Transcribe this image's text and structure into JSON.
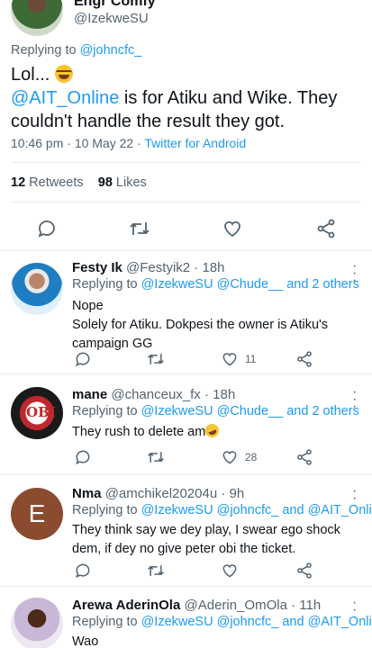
{
  "main_tweet": {
    "author_name": "Engr Comfy",
    "author_handle": "@IzekweSU",
    "replying_to_prefix": "Replying to ",
    "replying_to": "@johncfc_",
    "text_line1": "Lol... ",
    "mention": "@AIT_Online",
    "text_rest": " is for Atiku and Wike. They couldn't handle the result they got.",
    "time_date": "10:46 pm · 10 May 22 · ",
    "source": "Twitter for Android",
    "retweets": "12",
    "retweets_label": "Retweets",
    "likes": "98",
    "likes_label": "Likes"
  },
  "replies": [
    {
      "name": "Festy Ik",
      "handle_time": "@Festyik2 · 18h",
      "replying_prefix": "Replying to ",
      "replying_mentions": "@IzekweSU @Chude__ and 2 others",
      "text": "Nope\nSolely for Atiku. Dokpesi the owner is Atiku's campaign GG",
      "like_count": "11"
    },
    {
      "name": "mane",
      "handle_time": "@chanceux_fx · 18h",
      "replying_prefix": "Replying to ",
      "replying_mentions": "@IzekweSU @Chude__ and 2 others",
      "text": "They rush to delete am",
      "like_count": "28",
      "avatar_text": "OBI"
    },
    {
      "name": "Nma",
      "handle_time": "@amchikel20204u · 9h",
      "replying_prefix": "Replying to ",
      "replying_mentions": "@IzekweSU @johncfc_ and @AIT_Online",
      "text": "They think say we dey play, I swear ego shock dem, if dey no give peter obi the ticket.",
      "like_count": "",
      "avatar_letter": "E"
    },
    {
      "name": "Arewa AderinOla",
      "handle_time": "@Aderin_OmOla · 11h",
      "replying_prefix": "Replying to ",
      "replying_mentions": "@IzekweSU @johncfc_ and @AIT_Online",
      "text": "Wao"
    }
  ],
  "colors": {
    "accent": "#1d9bf0",
    "text": "#0f1419",
    "muted": "#536471",
    "divider": "#e6ecf0"
  },
  "icons": [
    "reply-icon",
    "retweet-icon",
    "like-icon",
    "share-icon",
    "more-icon"
  ]
}
